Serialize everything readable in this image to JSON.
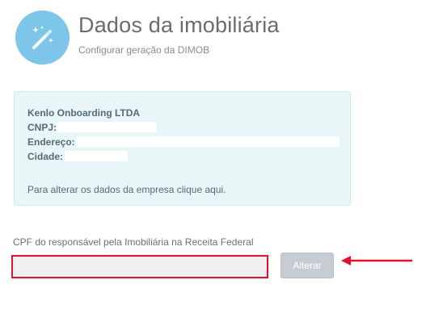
{
  "header": {
    "icon": "magic-wand-icon",
    "title": "Dados da imobiliária",
    "subtitle": "Configurar geração da DIMOB"
  },
  "company": {
    "name": "Kenlo Onboarding LTDA",
    "cnpj_label": "CNPJ:",
    "endereco_label": "Endereço:",
    "cidade_label": "Cidade:",
    "edit_hint": "Para alterar os dados da empresa clique aqui."
  },
  "responsavel": {
    "cpf_label": "CPF do responsável pela Imobiliária na Receita Federal",
    "cpf_value": "",
    "cpf_placeholder": "",
    "alter_button_label": "Alterar"
  },
  "colors": {
    "accent_circle": "#7ec6e9",
    "info_box_bg": "#e8f6f8",
    "highlight_red": "#e3122b",
    "button_disabled": "#c5ccd2"
  }
}
